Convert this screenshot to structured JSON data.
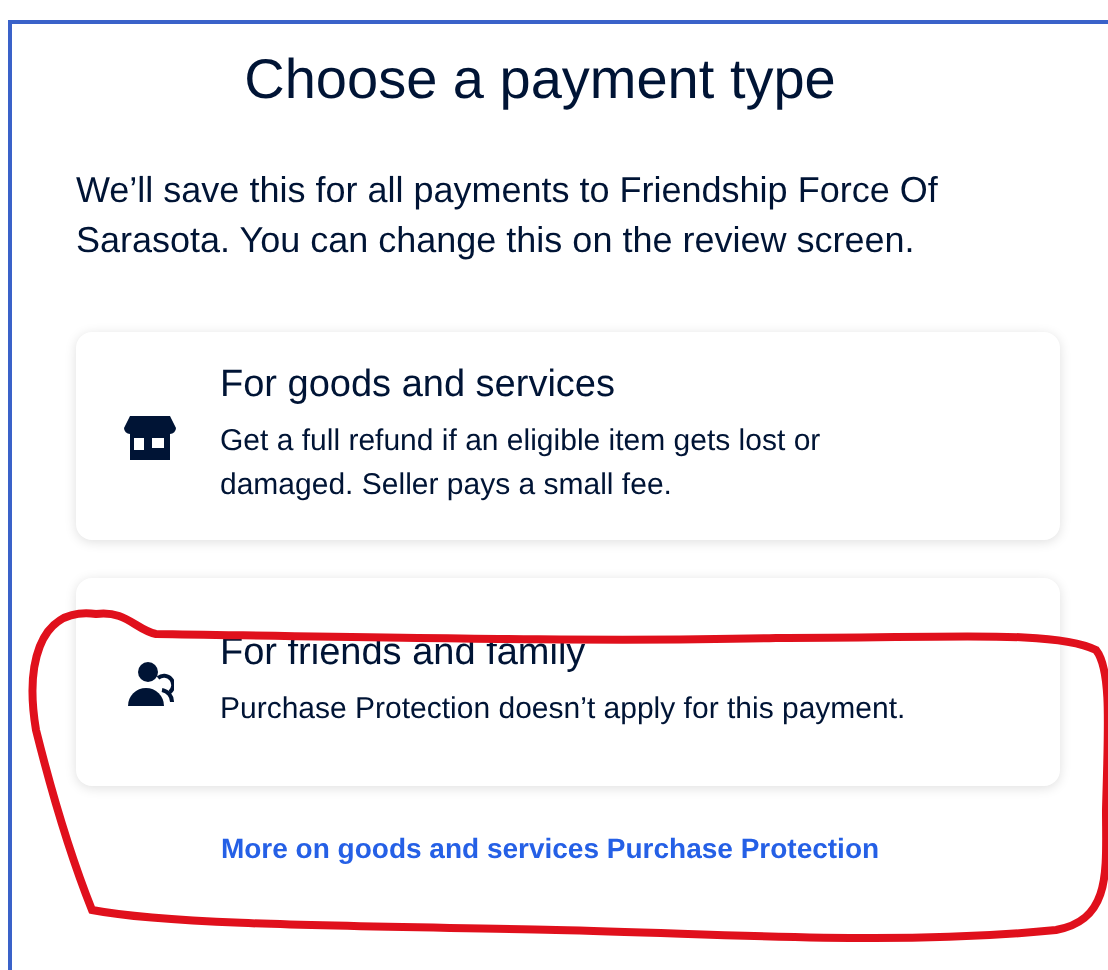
{
  "title": "Choose a payment type",
  "intro": "We’ll save this for all payments to Friendship Force Of Sarasota. You can change this on the review screen.",
  "options": [
    {
      "kind": "store",
      "title": "For goods and services",
      "description": "Get a full refund if an eligible item gets lost or damaged. Seller pays a small fee."
    },
    {
      "kind": "people",
      "title": "For friends and family",
      "description": "Purchase Protection doesn’t apply for this payment."
    }
  ],
  "link": "More on goods and services Purchase Protection"
}
